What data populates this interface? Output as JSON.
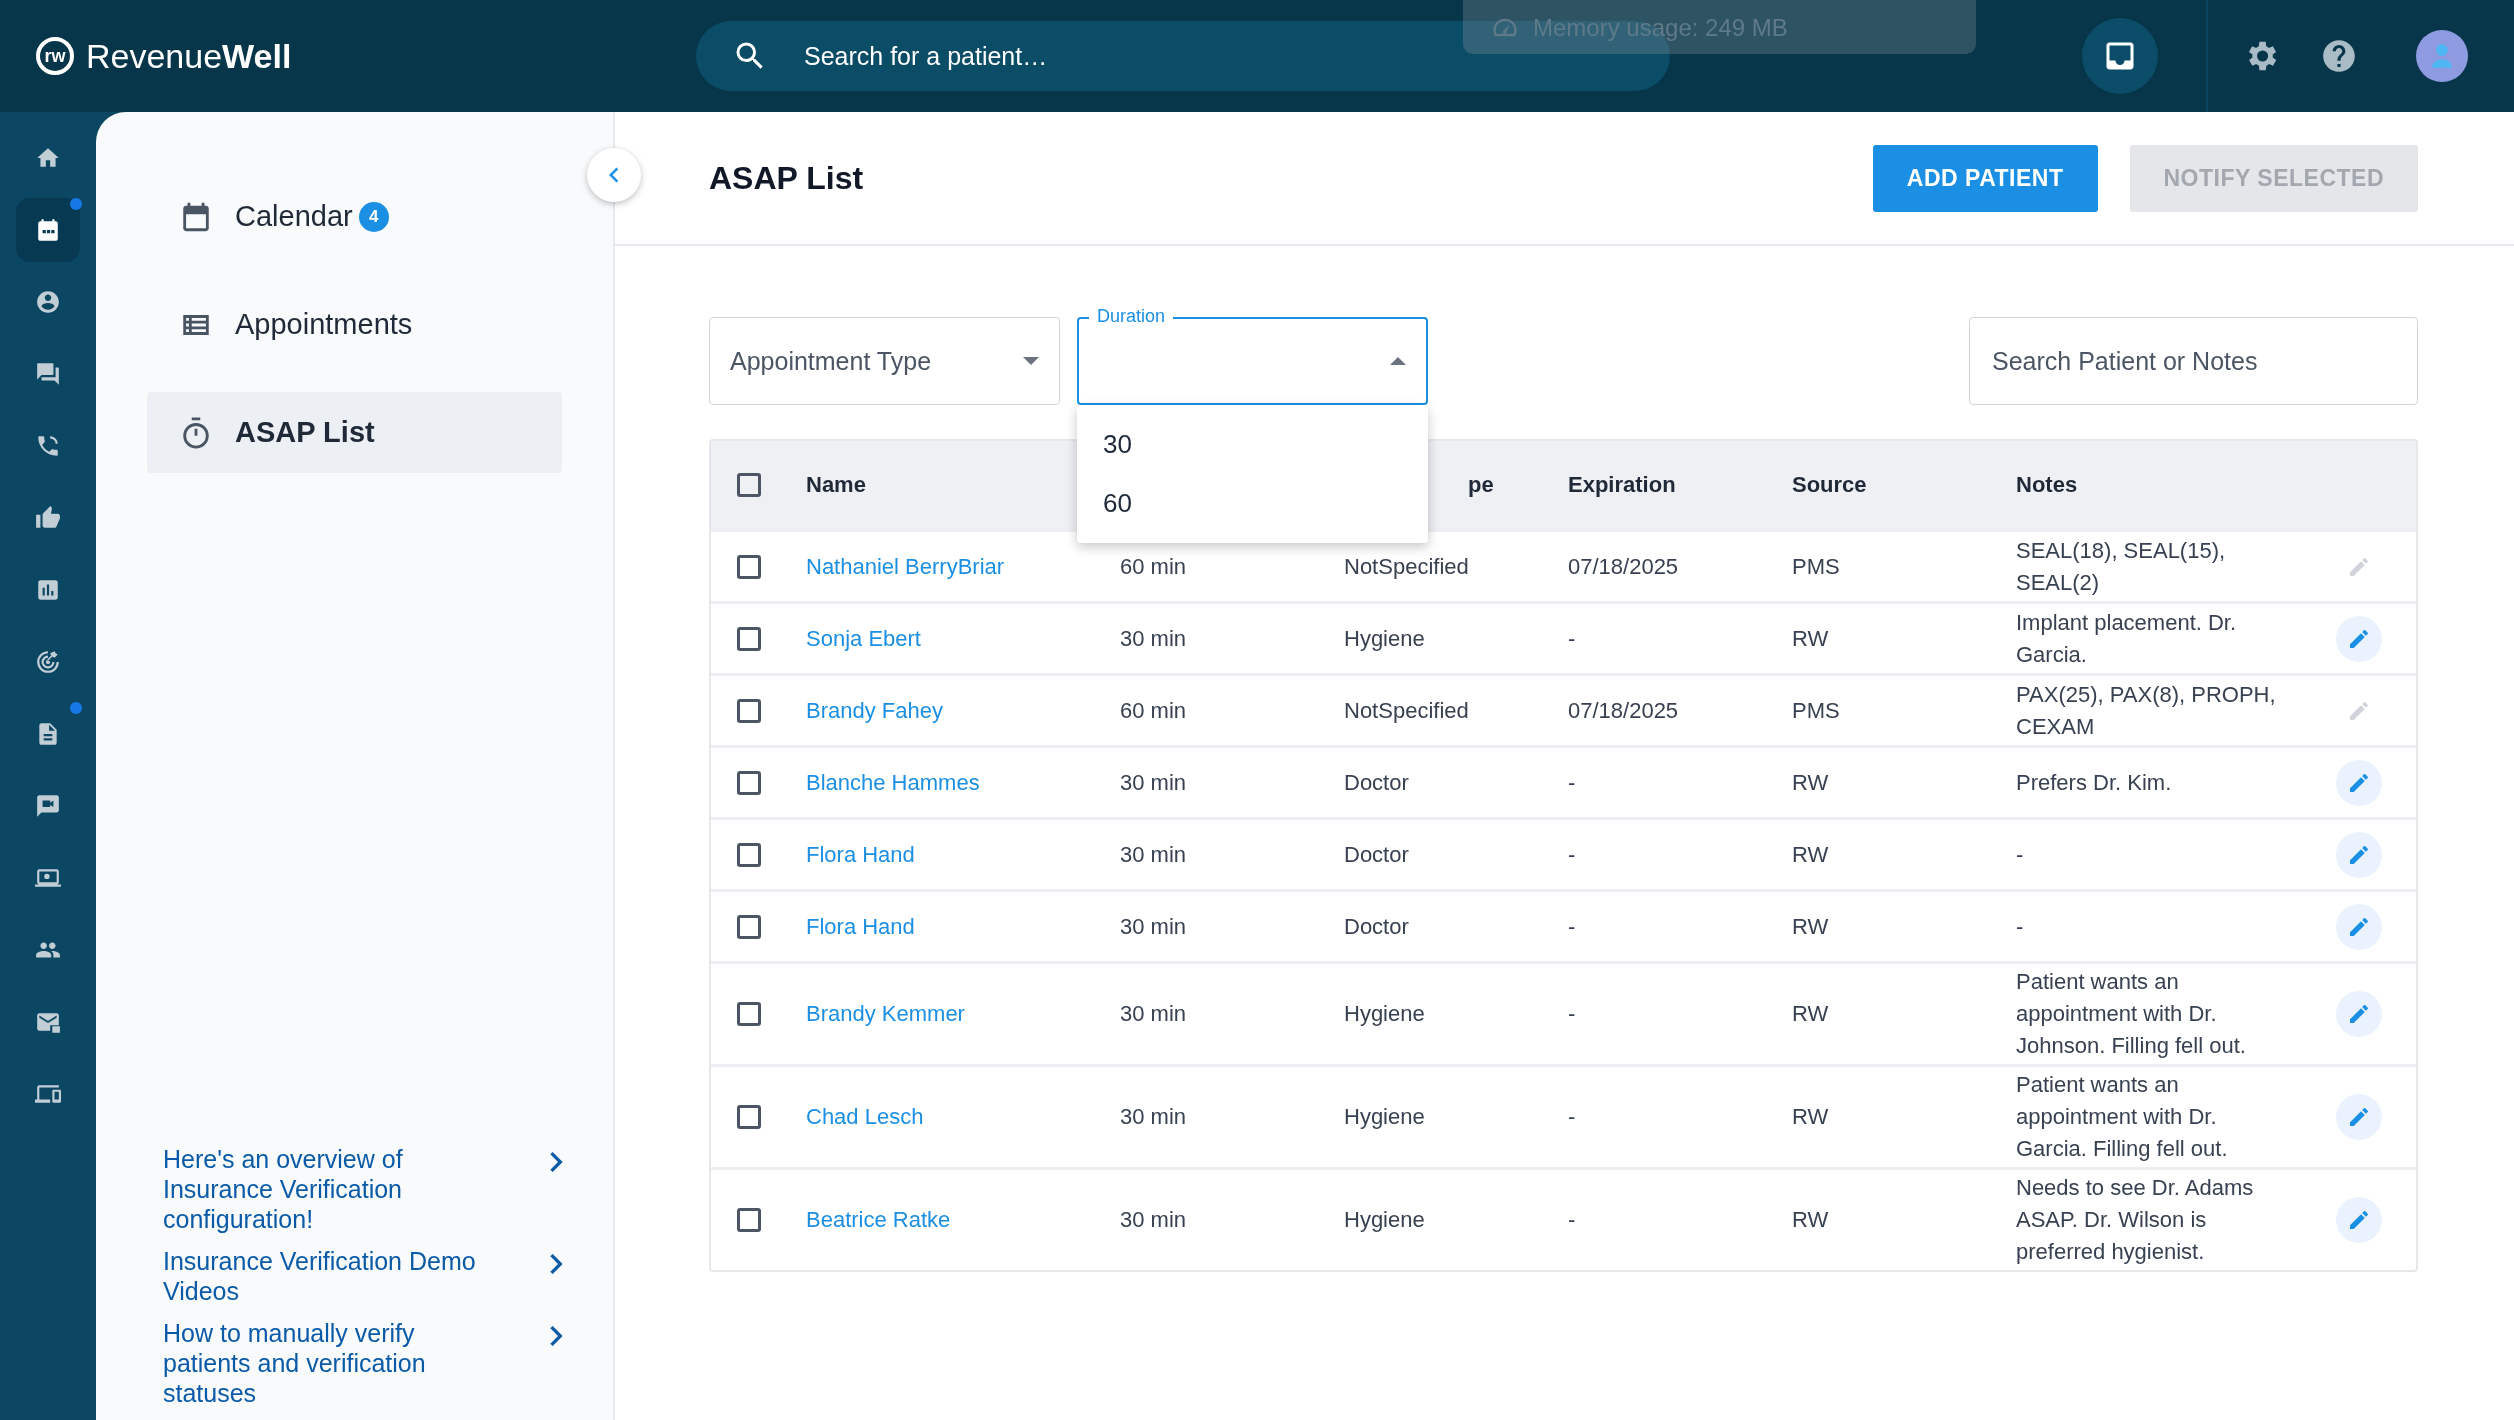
{
  "topbar": {
    "logo_mark": "rw",
    "logo_text": "Revenue**Well**",
    "search": {
      "placeholder": "Search for a patient…"
    },
    "memory_toast": "Memory usage: 249 MB"
  },
  "nav_rail": [
    {
      "selected": false,
      "notification": false
    },
    {
      "selected": true,
      "notification": true
    },
    {
      "selected": false,
      "notification": false
    },
    {
      "selected": false,
      "notification": false
    },
    {
      "selected": false,
      "notification": false
    },
    {
      "selected": false,
      "notification": false
    },
    {
      "selected": false,
      "notification": false
    },
    {
      "selected": false,
      "notification": false
    },
    {
      "selected": false,
      "notification": true
    },
    {
      "selected": false,
      "notification": false
    },
    {
      "selected": false,
      "notification": false
    },
    {
      "selected": false,
      "notification": false
    },
    {
      "selected": false,
      "notification": false
    },
    {
      "selected": false,
      "notification": false
    }
  ],
  "sidebar": {
    "items": [
      {
        "label": "Calendar",
        "badge": "4",
        "selected": false
      },
      {
        "label": "Appointments",
        "selected": false
      },
      {
        "label": "ASAP List",
        "selected": true
      }
    ],
    "help_links": [
      "Here's an overview of Insurance Verification configuration!",
      "Insurance Verification Demo Videos",
      "How to manually verify patients and verification statuses"
    ]
  },
  "page": {
    "title": "ASAP List",
    "buttons": [
      {
        "label": "ADD PATIENT",
        "disabled": false
      },
      {
        "label": "NOTIFY SELECTED",
        "disabled": true
      }
    ]
  },
  "filters": {
    "appointment_type": {
      "placeholder": "Appointment Type"
    },
    "duration": {
      "label": "Duration",
      "expanded": true,
      "options": [
        "30",
        "60"
      ]
    },
    "search": {
      "placeholder": "Search Patient or Notes"
    }
  },
  "table": {
    "select_all_checked": false,
    "columns": {
      "name": "Name",
      "column_3": "pe",
      "expiration": "Expiration",
      "source": "Source",
      "notes": "Notes"
    },
    "rows": [
      {
        "name": "Nathaniel BerryBriar",
        "duration": "60 min",
        "type": "NotSpecified",
        "expiration": "07/18/2025",
        "source": "PMS",
        "notes": "SEAL(18), SEAL(15), SEAL(2)",
        "checked": false,
        "edit_enabled": false
      },
      {
        "name": "Sonja Ebert",
        "duration": "30 min",
        "type": "Hygiene",
        "expiration": "-",
        "source": "RW",
        "notes": "Implant placement. Dr. Garcia.",
        "checked": false,
        "edit_enabled": true
      },
      {
        "name": "Brandy Fahey",
        "duration": "60 min",
        "type": "NotSpecified",
        "expiration": "07/18/2025",
        "source": "PMS",
        "notes": "PAX(25), PAX(8), PROPH, CEXAM",
        "checked": false,
        "edit_enabled": false
      },
      {
        "name": "Blanche Hammes",
        "duration": "30 min",
        "type": "Doctor",
        "expiration": "-",
        "source": "RW",
        "notes": "Prefers Dr. Kim.",
        "checked": false,
        "edit_enabled": true
      },
      {
        "name": "Flora Hand",
        "duration": "30 min",
        "type": "Doctor",
        "expiration": "-",
        "source": "RW",
        "notes": "-",
        "checked": false,
        "edit_enabled": true
      },
      {
        "name": "Flora Hand",
        "duration": "30 min",
        "type": "Doctor",
        "expiration": "-",
        "source": "RW",
        "notes": "-",
        "checked": false,
        "edit_enabled": true
      },
      {
        "name": "Brandy Kemmer",
        "duration": "30 min",
        "type": "Hygiene",
        "expiration": "-",
        "source": "RW",
        "notes": "Patient wants an appointment with Dr. Johnson. Filling fell out.",
        "checked": false,
        "edit_enabled": true
      },
      {
        "name": "Chad Lesch",
        "duration": "30 min",
        "type": "Hygiene",
        "expiration": "-",
        "source": "RW",
        "notes": "Patient wants an appointment with Dr. Garcia. Filling fell out.",
        "checked": false,
        "edit_enabled": true
      },
      {
        "name": "Beatrice Ratke",
        "duration": "30 min",
        "type": "Hygiene",
        "expiration": "-",
        "source": "RW",
        "notes": "Needs to see Dr. Adams ASAP. Dr. Wilson is preferred hygienist.",
        "checked": false,
        "edit_enabled": true
      }
    ]
  }
}
